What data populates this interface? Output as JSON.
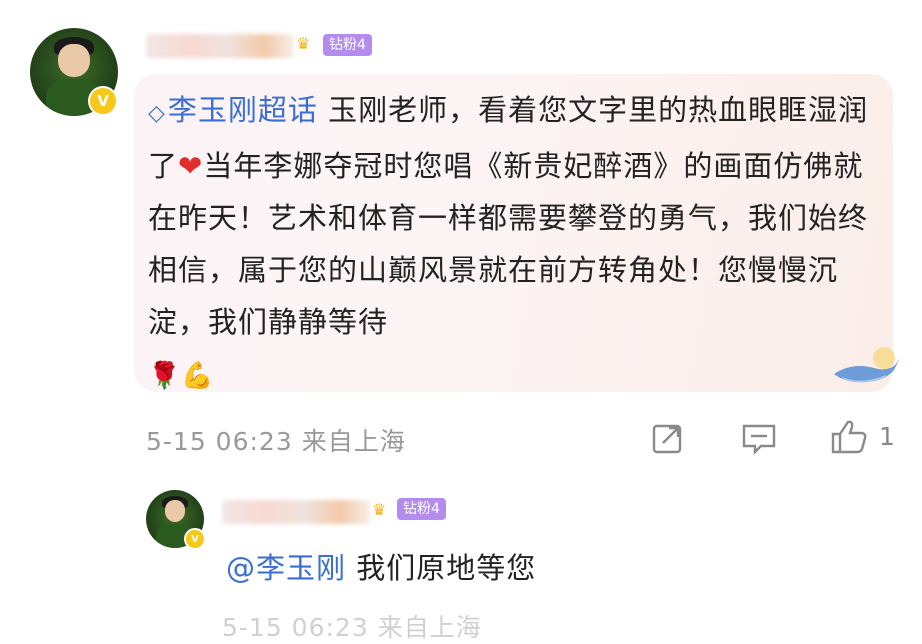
{
  "comment": {
    "fan_badge": "钻粉4",
    "topic_link": "李玉刚超话",
    "text_part1": " 玉刚老师，看着您文字里的热血眼眶湿润了",
    "text_part2": "当年李娜夺冠时您唱《新贵妃醉酒》的画面仿佛就在昨天！艺术和体育一样都需要攀登的勇气，我们始终相信，属于您的山巅风景就在前方转角处！您慢慢沉淀，我们静静等待",
    "heart_emoji": "❤",
    "rose_emoji": "🌹",
    "muscle_emoji": "💪",
    "timestamp": "5-15 06:23",
    "location": "来自上海",
    "like_count": "1",
    "verified_badge": "V"
  },
  "reply": {
    "fan_badge": "钻粉4",
    "mention": "@李玉刚",
    "text": " 我们原地等您",
    "timestamp": "5-15 06:23",
    "location": "来自上海",
    "verified_badge": "V"
  },
  "colors": {
    "link": "#3a6ed6",
    "fan_badge": "#b48cf0",
    "verified": "#f7c71a",
    "meta": "#999999"
  },
  "icons": [
    "diamond-icon",
    "share-icon",
    "comment-icon",
    "like-icon",
    "whale-icon",
    "crown-icon"
  ]
}
